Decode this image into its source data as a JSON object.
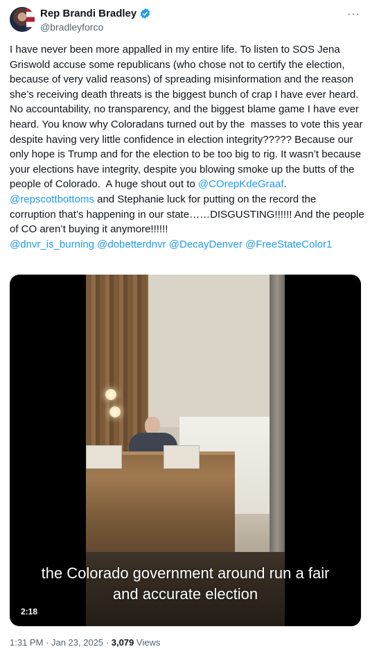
{
  "author": {
    "display_name": "Rep Brandi Bradley",
    "handle": "@bradleyforco",
    "verified_icon": "verified-badge-icon",
    "accent": "#1d9bf0"
  },
  "more_label": "···",
  "tweet": {
    "p1": "I have never been more appalled in my entire life. To listen to SOS Jena Griswold accuse some republicans (who chose not to certify the election, because of very valid reasons) of spreading misinformation and the reason she’s receiving death threats is the biggest bunch of crap I have ever heard. No accountability, no transparency, and the biggest blame game I have ever heard. You know why Coloradans turned out by the  masses to vote this year despite having very little confidence in election integrity????? Because our only hope is Trump and for the election to be too big to rig. It wasn’t because your elections have integrity, despite you blowing smoke up the butts of the people of Colorado.  A huge shout out to ",
    "m1": "@COrepKdeGraaf",
    "p2": ". ",
    "m2": "@repscottbottoms",
    "p3": " and Stephanie luck for putting on the record the corruption that’s happening in our state……DISGUSTING!!!!!! And the people of CO aren’t buying it anymore!!!!!!\n",
    "m3": "@dnvr_is_burning",
    "m4": "@dobetterdnvr",
    "m5": "@DecayDenver",
    "m6": "@FreeStateColor1"
  },
  "video": {
    "caption_line1": "the Colorado government around run a fair",
    "caption_line2": "and accurate election",
    "duration": "2:18"
  },
  "meta": {
    "time": "1:31 PM",
    "sep": " · ",
    "date": "Jan 23, 2025",
    "views_count": "3,079",
    "views_label": " Views"
  }
}
